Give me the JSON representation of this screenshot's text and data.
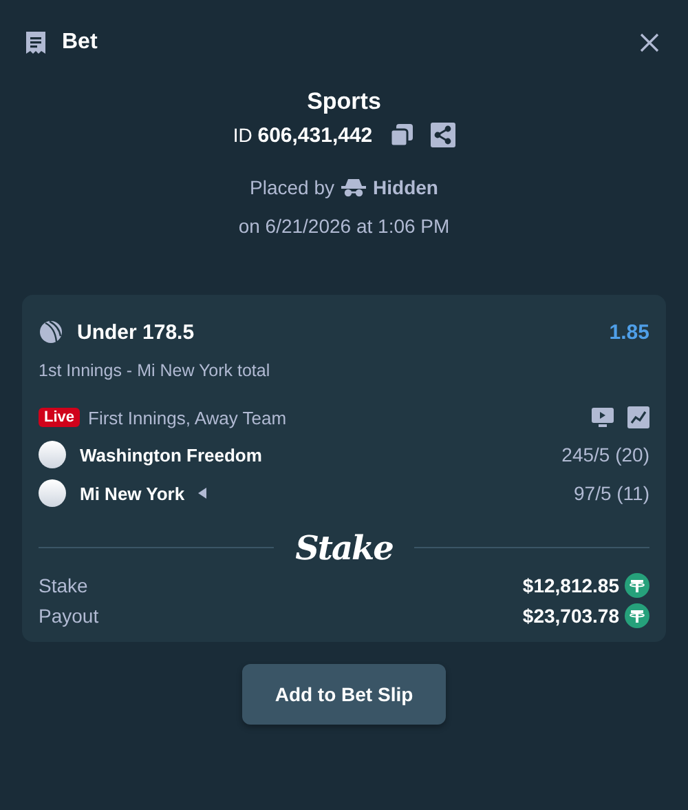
{
  "header": {
    "title": "Bet"
  },
  "summary": {
    "title": "Sports",
    "id_label": "ID",
    "id_value": "606,431,442",
    "placed_by_label": "Placed by",
    "placed_by_user": "Hidden",
    "placed_on": "on 6/21/2026 at 1:06 PM"
  },
  "bet": {
    "selection": "Under 178.5",
    "odds": "1.85",
    "market": "1st Innings - Mi New York total",
    "live": "Live",
    "event_status": "First Innings, Away Team",
    "teams": [
      {
        "name": "Washington Freedom",
        "score": "245/5 (20)",
        "batting": false
      },
      {
        "name": "Mi New York",
        "score": "97/5 (11)",
        "batting": true
      }
    ],
    "brand": "Stake",
    "totals": [
      {
        "label": "Stake",
        "amount": "$12,812.85"
      },
      {
        "label": "Payout",
        "amount": "$23,703.78"
      }
    ]
  },
  "action": {
    "label": "Add to Bet Slip"
  }
}
